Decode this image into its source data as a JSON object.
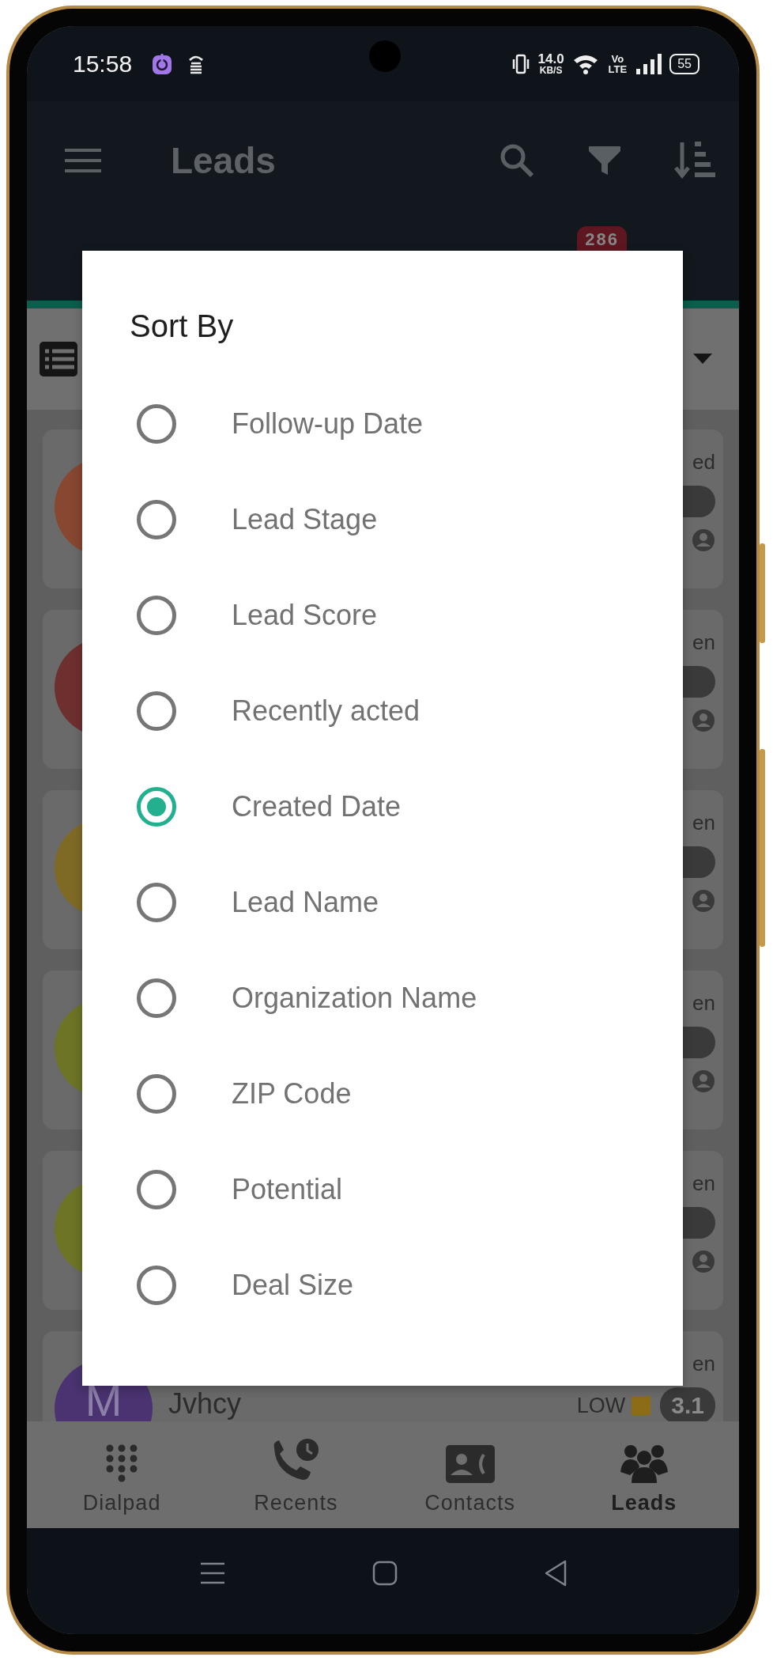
{
  "status_bar": {
    "time": "15:58",
    "speed": "14.0",
    "speed_unit": "KB/S",
    "volte_top": "Vo",
    "volte_bottom": "LTE",
    "battery": "55"
  },
  "app_bar": {
    "title": "Leads",
    "count_badge": "286"
  },
  "leads": [
    {
      "color": "#874730",
      "status": "ed"
    },
    {
      "color": "#6e2f2f",
      "status": "en"
    },
    {
      "color": "#7f6a25",
      "status": "en"
    },
    {
      "color": "#6d7425",
      "status": "en"
    },
    {
      "color": "#6d7425",
      "status": "en"
    },
    {
      "color": "#4a3370",
      "status": "en",
      "initial": "M",
      "name": "Jvhcy",
      "priority": {
        "text": "LOW",
        "color": "#8c6c14"
      },
      "score": "3.1"
    }
  ],
  "sort_dialog": {
    "title": "Sort By",
    "options": [
      {
        "label": "Follow-up Date",
        "selected": false
      },
      {
        "label": "Lead Stage",
        "selected": false
      },
      {
        "label": "Lead Score",
        "selected": false
      },
      {
        "label": "Recently acted",
        "selected": false
      },
      {
        "label": "Created Date",
        "selected": true
      },
      {
        "label": "Lead Name",
        "selected": false
      },
      {
        "label": "Organization Name",
        "selected": false
      },
      {
        "label": "ZIP Code",
        "selected": false
      },
      {
        "label": "Potential",
        "selected": false
      },
      {
        "label": "Deal Size",
        "selected": false
      }
    ]
  },
  "bottom_nav": [
    {
      "label": "Dialpad",
      "kind": "dialpad",
      "selected": false
    },
    {
      "label": "Recents",
      "kind": "recents",
      "selected": false
    },
    {
      "label": "Contacts",
      "kind": "contacts",
      "selected": false
    },
    {
      "label": "Leads",
      "kind": "leads",
      "selected": true
    }
  ]
}
